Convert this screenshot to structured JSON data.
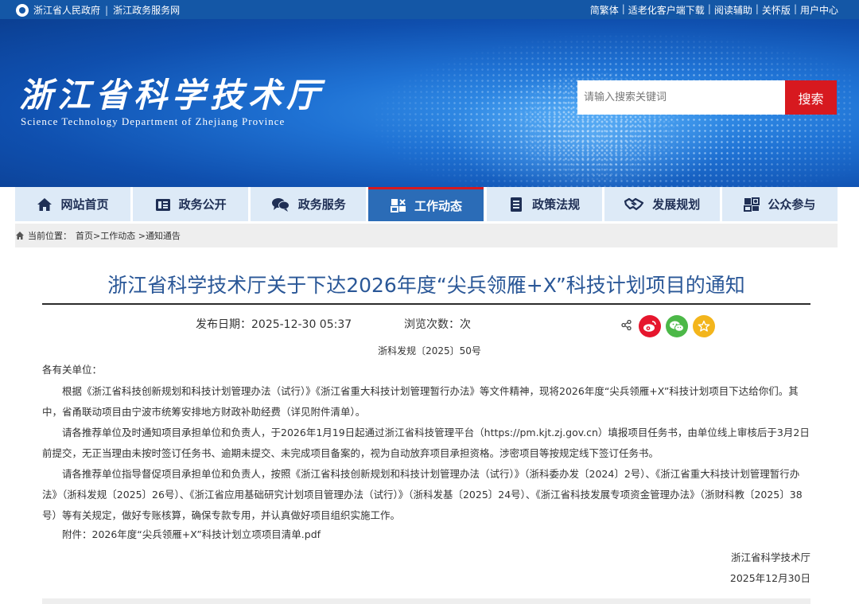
{
  "topbar": {
    "left": [
      "浙江省人民政府",
      "浙江政务服务网"
    ],
    "right": [
      "简繁体",
      "适老化客户端下载",
      "阅读辅助",
      "关怀版",
      "用户中心"
    ]
  },
  "banner": {
    "title_cn": "浙江省科学技术厅",
    "title_en": "Science Technology Department of Zhejiang Province",
    "search_placeholder": "请输入搜索关键词",
    "search_button": "搜索"
  },
  "nav": [
    {
      "label": "网站首页",
      "icon": "home-icon"
    },
    {
      "label": "政务公开",
      "icon": "document-list-icon"
    },
    {
      "label": "政务服务",
      "icon": "chat-bubbles-icon"
    },
    {
      "label": "工作动态",
      "icon": "workflow-icon",
      "active": true
    },
    {
      "label": "政策法规",
      "icon": "policy-document-icon"
    },
    {
      "label": "发展规划",
      "icon": "handshake-icon"
    },
    {
      "label": "公众参与",
      "icon": "people-icon"
    }
  ],
  "breadcrumb": {
    "prefix": "当前位置：",
    "items": [
      "首页>",
      "工作动态 >",
      "通知通告"
    ]
  },
  "article": {
    "title": "浙江省科学技术厅关于下达2026年度“尖兵领雁+X”科技计划项目的通知",
    "date_label": "发布日期：2025-12-30 05:37",
    "views_label": "浏览次数：次",
    "doc_no": "浙科发规〔2025〕50号",
    "salutation": "各有关单位：",
    "paragraphs": [
      "根据《浙江省科技创新规划和科技计划管理办法（试行）》《浙江省重大科技计划管理暂行办法》等文件精神，现将2026年度“尖兵领雁+X”科技计划项目下达给你们。其中，省甬联动项目由宁波市统筹安排地方财政补助经费（详见附件清单）。",
      "请各推荐单位及时通知项目承担单位和负责人，于2026年1月19日起通过浙江省科技管理平台（https://pm.kjt.zj.gov.cn）填报项目任务书，由单位线上审核后于3月2日前提交，无正当理由未按时签订任务书、逾期未提交、未完成项目备案的，视为自动放弃项目承担资格。涉密项目等按规定线下签订任务书。",
      "请各推荐单位指导督促项目承担单位和负责人，按照《浙江省科技创新规划和科技计划管理办法（试行）》（浙科委办发〔2024〕2号）、《浙江省重大科技计划管理暂行办法》（浙科发规〔2025〕26号）、《浙江省应用基础研究计划项目管理办法（试行）》（浙科发基〔2025〕24号）、《浙江省科技发展专项资金管理办法》（浙财科教〔2025〕38号）等有关规定，做好专账核算，确保专款专用，并认真做好项目组织实施工作。",
      "附件：2026年度“尖兵领雁+X”科技计划立项项目清单.pdf"
    ],
    "signature": "浙江省科学技术厅",
    "sign_date": "2025年12月30日"
  },
  "colors": {
    "primary": "#1457a6",
    "accent_red": "#d7191f",
    "title_blue": "#2a5797",
    "weibo": "#e6162d",
    "wechat": "#4cb848",
    "favorite": "#f3b51c"
  }
}
